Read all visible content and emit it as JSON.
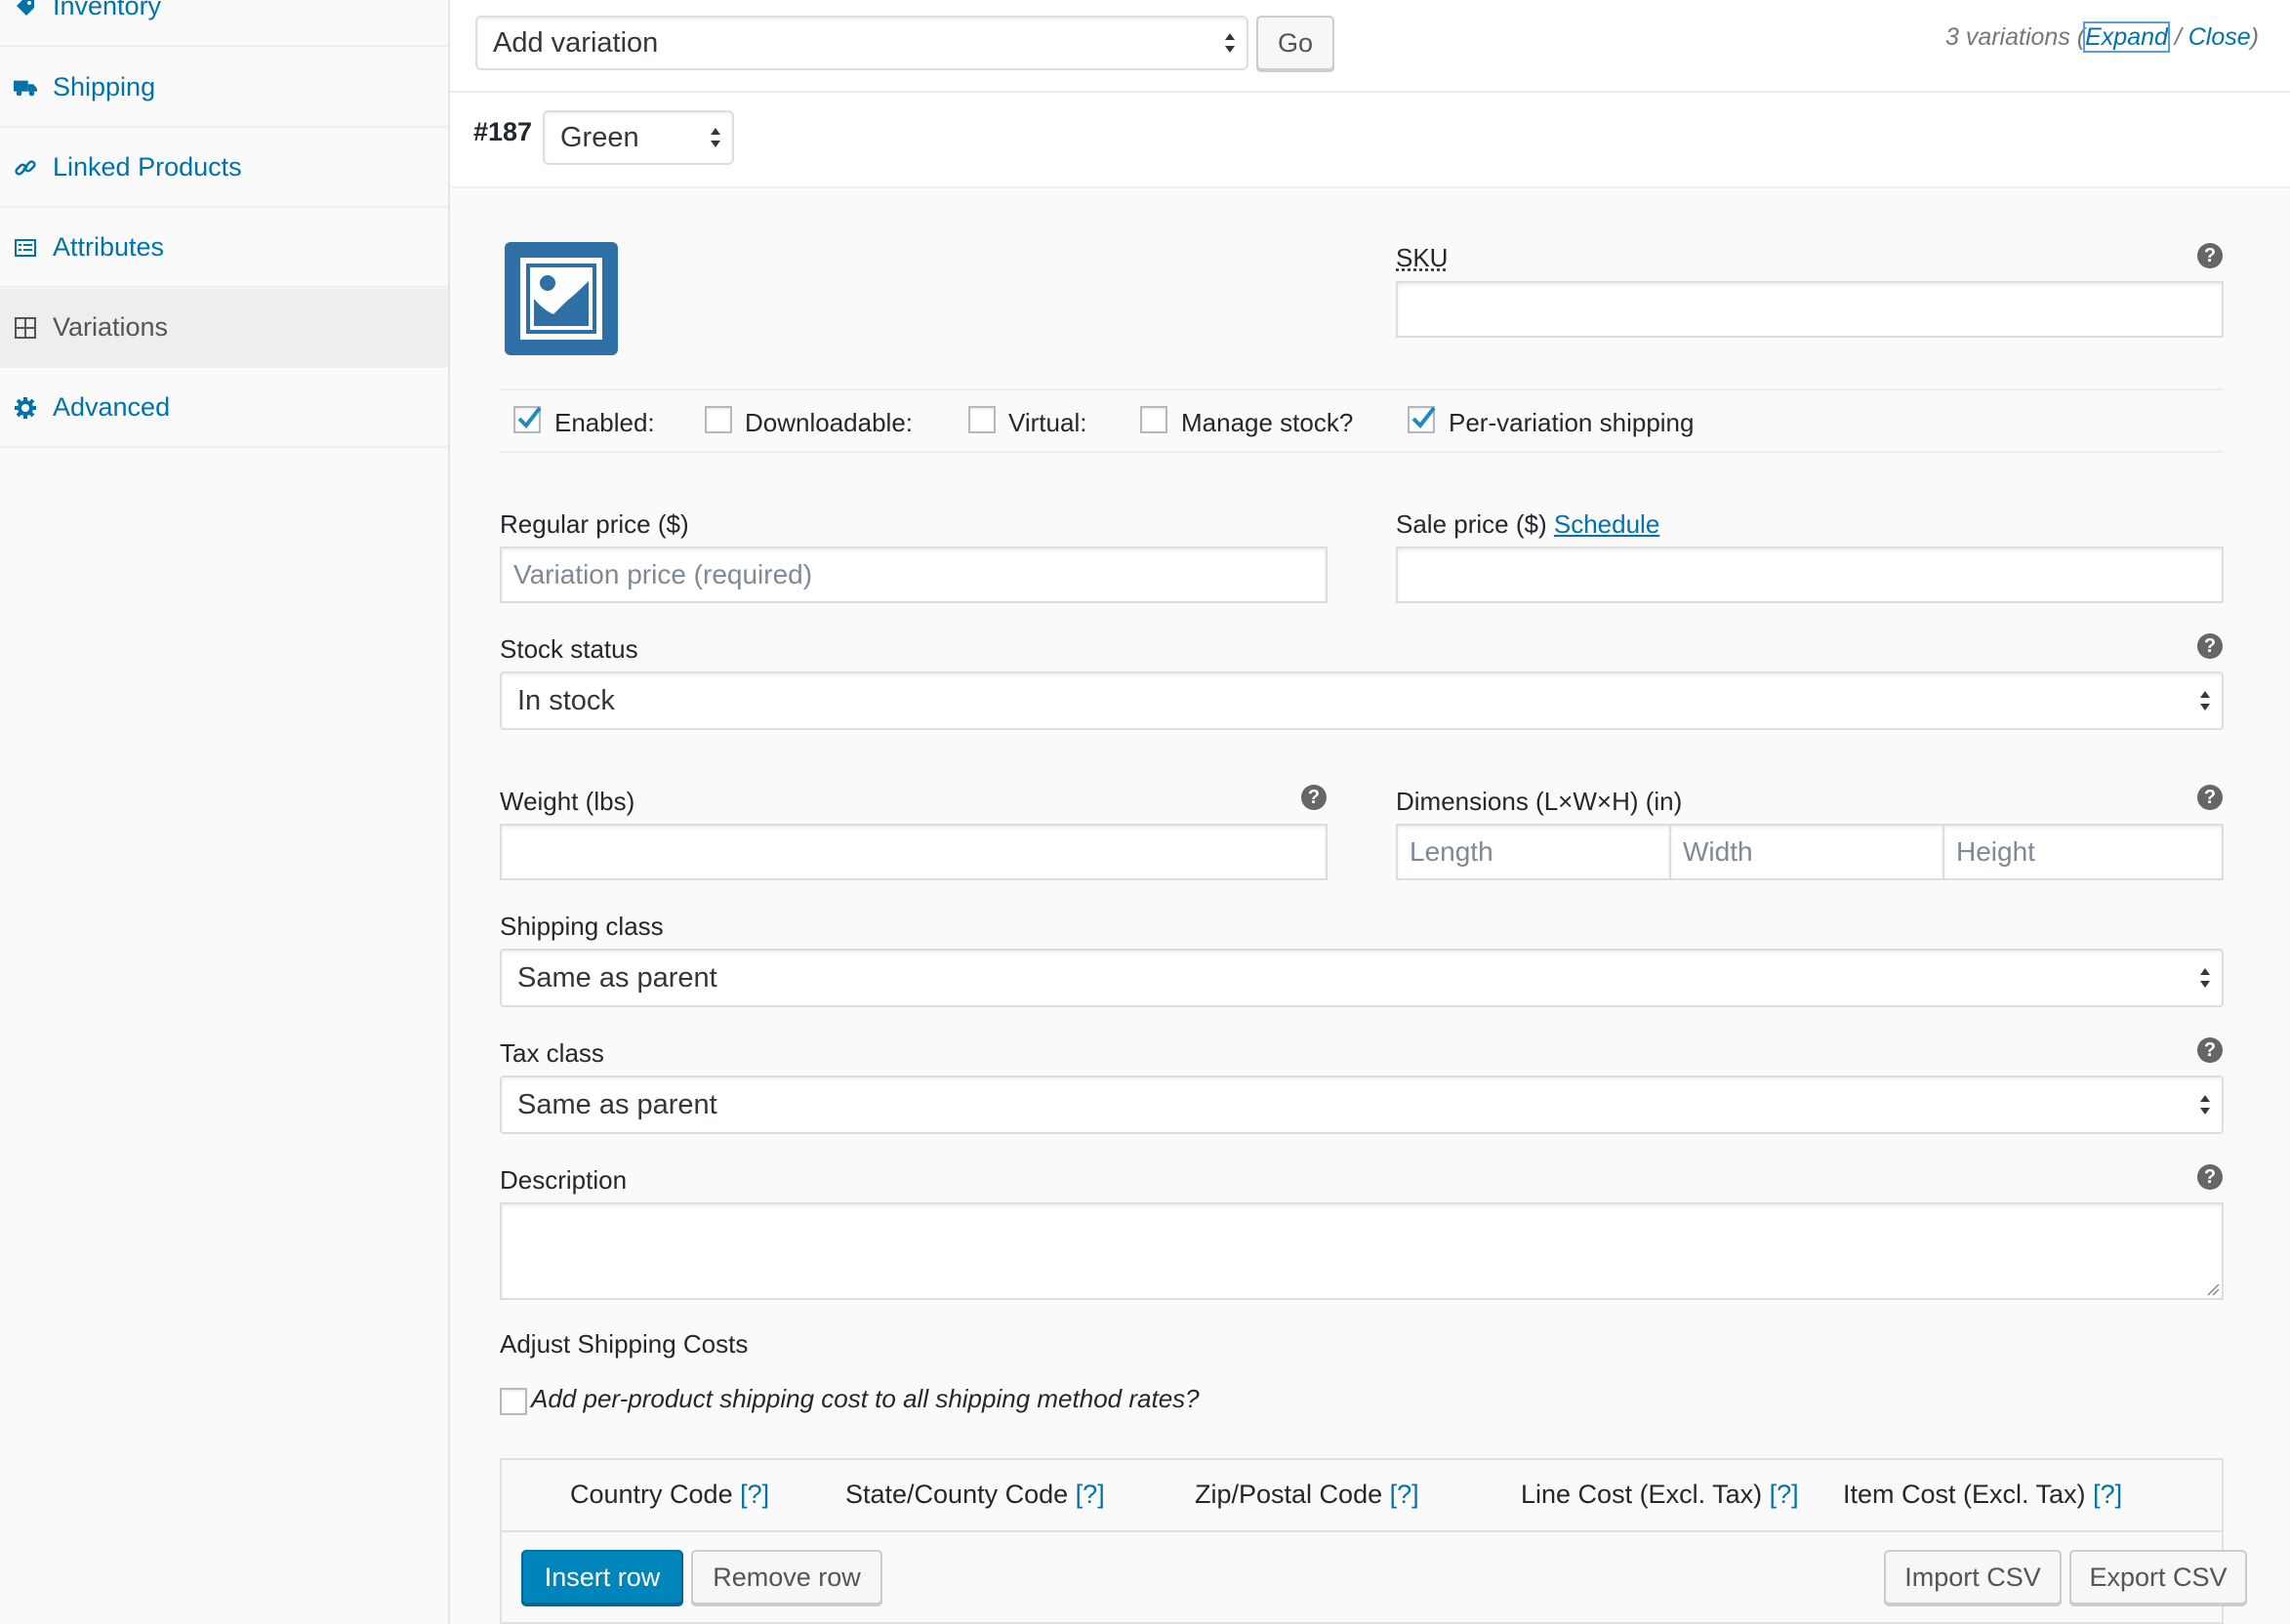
{
  "sidebar": {
    "items": [
      {
        "label": "Inventory",
        "icon": "tag-icon"
      },
      {
        "label": "Shipping",
        "icon": "truck-icon"
      },
      {
        "label": "Linked Products",
        "icon": "link-icon"
      },
      {
        "label": "Attributes",
        "icon": "list-icon"
      },
      {
        "label": "Variations",
        "icon": "grid-icon",
        "active": true
      },
      {
        "label": "Advanced",
        "icon": "gear-icon"
      }
    ]
  },
  "toolbar": {
    "action_select_value": "Add variation",
    "go_label": "Go",
    "variations_count": "3 variations",
    "paren_open": "(",
    "expand_label": "Expand",
    "separator": " / ",
    "close_label": "Close",
    "paren_close": ")"
  },
  "variation": {
    "id": "#187",
    "attribute_value": "Green",
    "sku_label": "SKU",
    "sku_value": "",
    "checkboxes": [
      {
        "label": "Enabled:",
        "checked": true
      },
      {
        "label": "Downloadable:",
        "checked": false
      },
      {
        "label": "Virtual:",
        "checked": false
      },
      {
        "label": "Manage stock?",
        "checked": false
      },
      {
        "label": "Per-variation shipping",
        "checked": true
      }
    ],
    "regular_price_label": "Regular price ($)",
    "regular_price_placeholder": "Variation price (required)",
    "sale_price_label": "Sale price ($)",
    "schedule_link": "Schedule",
    "stock_status_label": "Stock status",
    "stock_status_value": "In stock",
    "weight_label": "Weight (lbs)",
    "dimensions_label": "Dimensions (L×W×H) (in)",
    "length_placeholder": "Length",
    "width_placeholder": "Width",
    "height_placeholder": "Height",
    "shipping_class_label": "Shipping class",
    "shipping_class_value": "Same as parent",
    "tax_class_label": "Tax class",
    "tax_class_value": "Same as parent",
    "description_label": "Description",
    "help_glyph": "?"
  },
  "shipping_costs": {
    "heading": "Adjust Shipping Costs",
    "per_product_label": "Add per-product shipping cost to all shipping method rates?",
    "columns": [
      {
        "label": "Country Code",
        "help": "[?]"
      },
      {
        "label": "State/County Code",
        "help": "[?]"
      },
      {
        "label": "Zip/Postal Code",
        "help": "[?]"
      },
      {
        "label": "Line Cost (Excl. Tax)",
        "help": "[?]"
      },
      {
        "label": "Item Cost (Excl. Tax)",
        "help": "[?]"
      }
    ],
    "insert_row": "Insert row",
    "remove_row": "Remove row",
    "import_csv": "Import CSV",
    "export_csv": "Export CSV"
  },
  "colors": {
    "link": "#0073aa",
    "primary_button": "#0085ba",
    "image_placeholder": "#2e6fa6"
  }
}
